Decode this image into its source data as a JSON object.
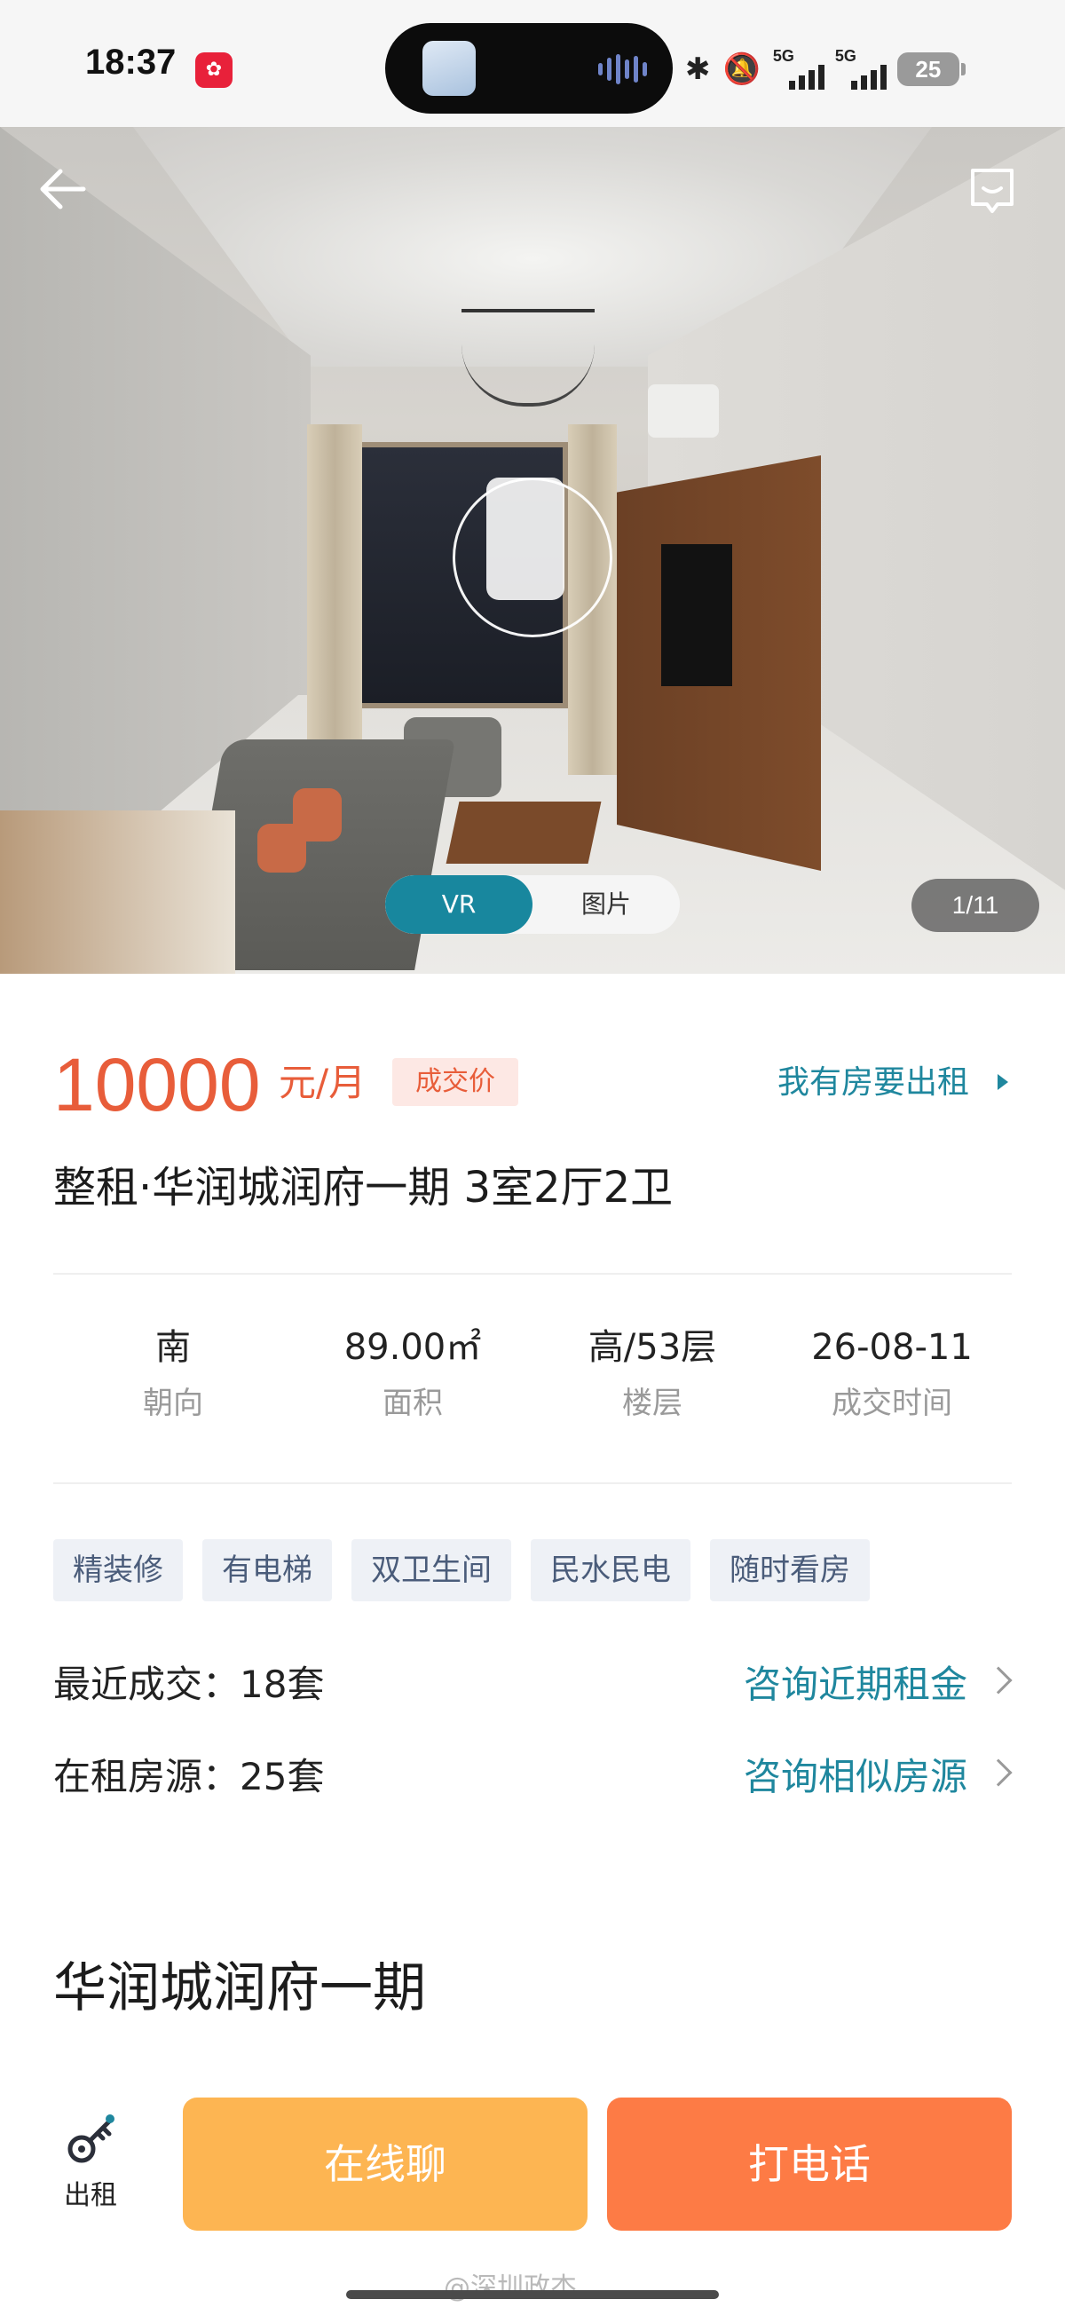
{
  "status_bar": {
    "time": "18:37",
    "signal_1_label": "5G",
    "signal_2_label": "5G",
    "battery": "25"
  },
  "gallery": {
    "tabs": [
      "VR",
      "图片"
    ],
    "active_tab": "VR",
    "counter": "1/11"
  },
  "listing": {
    "price": "10000",
    "price_unit": "元/月",
    "price_badge": "成交价",
    "rent_out_link": "我有房要出租",
    "title": "整租·华润城润府一期 3室2厅2卫",
    "facts": [
      {
        "value": "南",
        "label": "朝向"
      },
      {
        "value": "89.00㎡",
        "label": "面积"
      },
      {
        "value": "高/53层",
        "label": "楼层"
      },
      {
        "value": "26-08-11",
        "label": "成交时间"
      }
    ],
    "tags": [
      "精装修",
      "有电梯",
      "双卫生间",
      "民水民电",
      "随时看房"
    ],
    "recent_deals": {
      "label": "最近成交：18套",
      "action": "咨询近期租金"
    },
    "available": {
      "label": "在租房源：25套",
      "action": "咨询相似房源"
    },
    "community_name": "华润城润府一期"
  },
  "bottom_bar": {
    "rent_label": "出租",
    "chat_button": "在线聊",
    "call_button": "打电话"
  },
  "watermark": "@深圳政杰",
  "colors": {
    "accent_teal": "#1f879e",
    "price_red": "#e85d3a",
    "chat_orange": "#fdb552",
    "call_orange": "#fd7b45"
  }
}
